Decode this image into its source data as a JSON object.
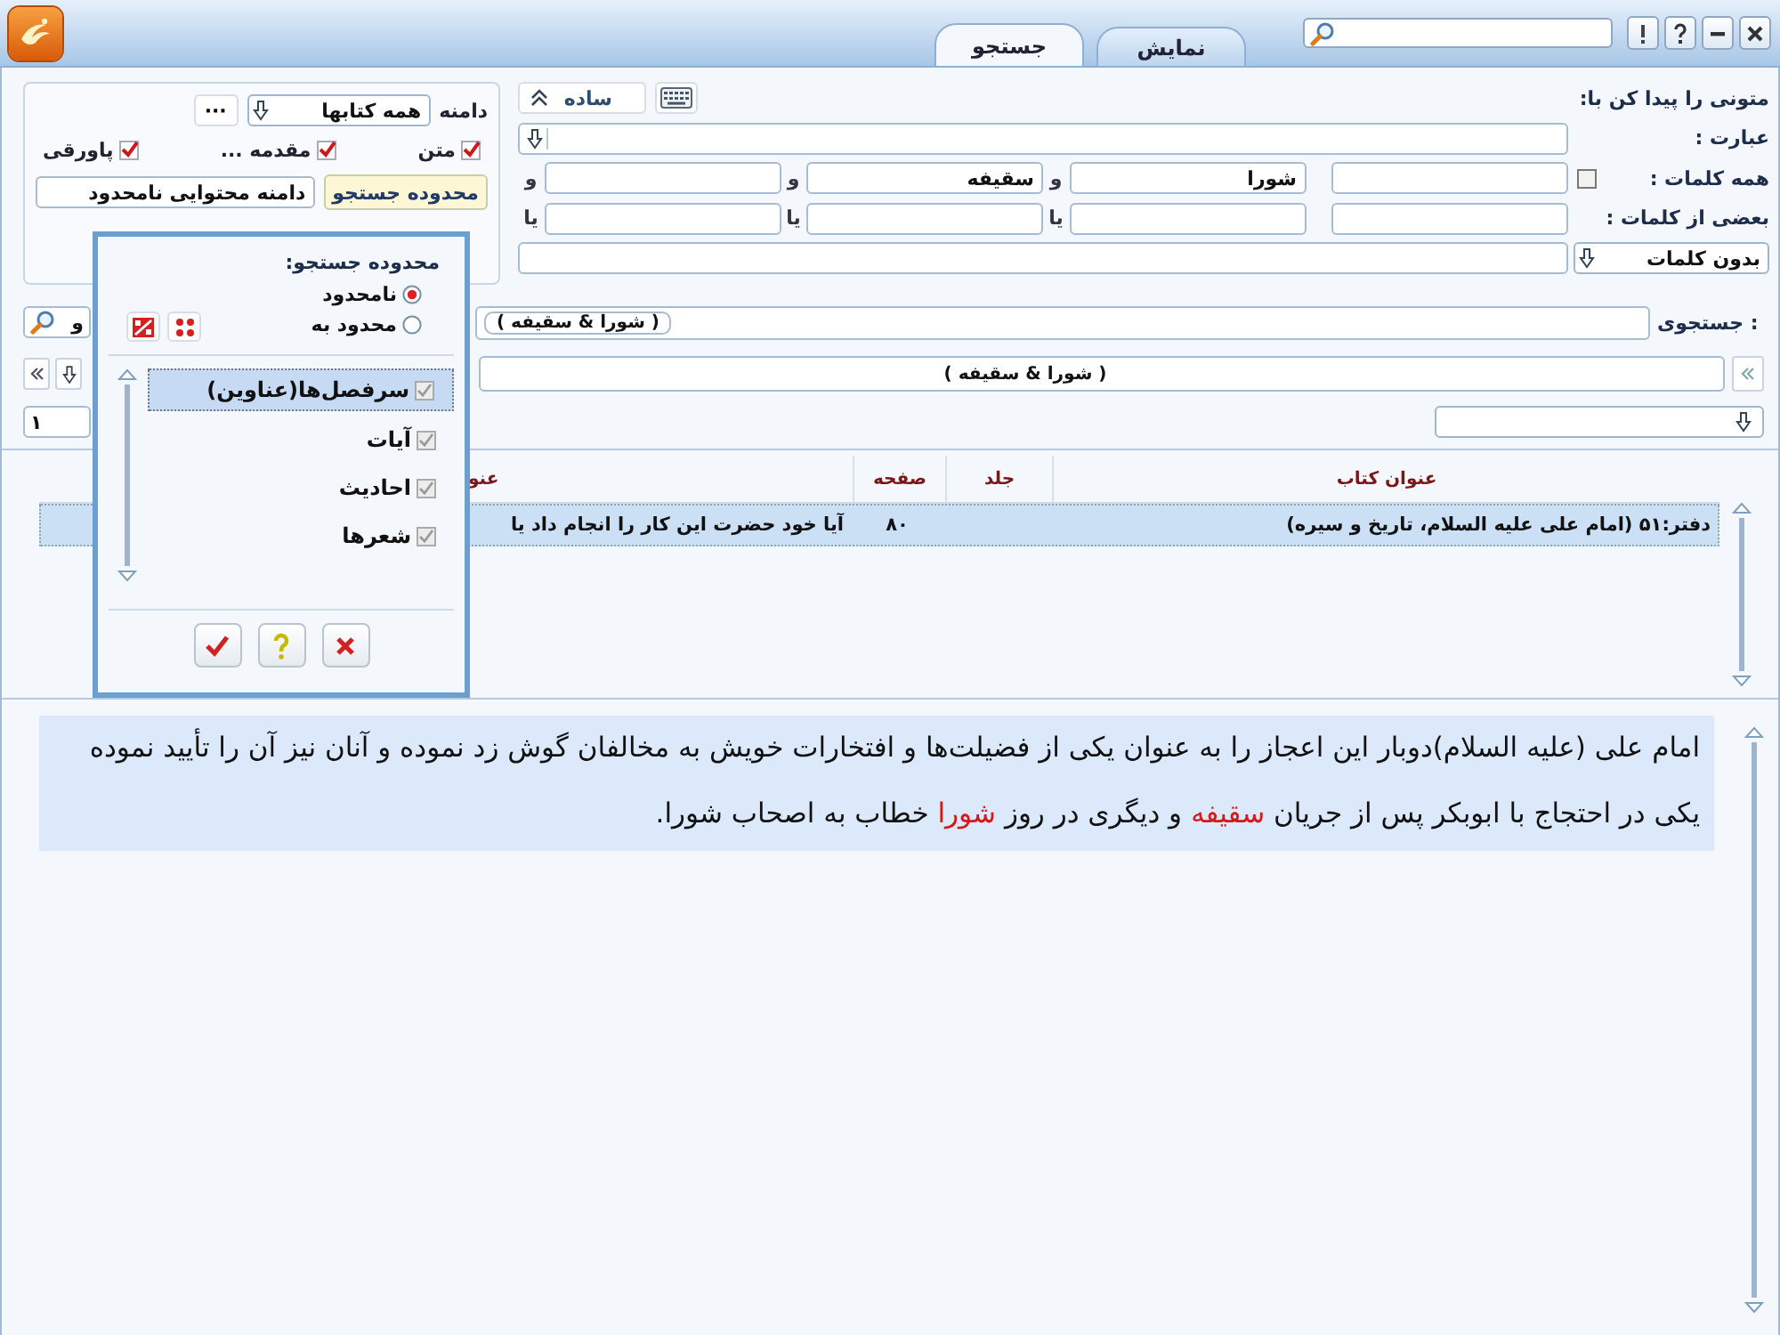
{
  "tabs": [
    {
      "label": "نمایش",
      "selected": false
    },
    {
      "label": "جستجو",
      "selected": true
    }
  ],
  "scope_panel": {
    "domain_label": "دامنه",
    "domain_value": "همه کتابها",
    "more_button": "···",
    "sections": [
      {
        "label": "متن",
        "checked": true
      },
      {
        "label": "مقدمه ...",
        "checked": true
      },
      {
        "label": "پاورقی",
        "checked": true
      }
    ],
    "scope_button": "محدوده جستجو",
    "scope_value": "دامنه محتوایی نامحدود"
  },
  "search_form": {
    "heading": "متونی را پیدا کن با:",
    "mode_button": "ساده",
    "phrase_label": "عبارت :",
    "all_words": {
      "label": "همه کلمات :",
      "checked": false,
      "connectors": [
        "و",
        "و",
        "و"
      ],
      "values": [
        "شورا",
        "سقیفه"
      ]
    },
    "some_words": {
      "label": "بعضی از کلمات :",
      "connectors": [
        "یا",
        "یا",
        "یا"
      ]
    },
    "exclude": {
      "mode": "بدون کلمات"
    }
  },
  "query": {
    "label": "جستجوی :",
    "value": "( شورا & سقیفه )",
    "side_value": "و"
  },
  "expression": {
    "value": "( شورا & سقیفه )"
  },
  "page_field": {
    "value": "۱"
  },
  "results": {
    "columns": [
      "عنوان کتاب",
      "جلد",
      "صفحه",
      "عنو"
    ],
    "rows": [
      {
        "book": "دفتر:۵۱ (امام علی علیه السلام، تاریخ و سیره)",
        "page": "۸۰",
        "title": "آیا خود حضرت این کار را انجام داد یا",
        "selected": true
      }
    ]
  },
  "excerpt": {
    "segments": [
      {
        "text": "امام علی (علیه السلام)دوبار این اعجاز را به عنوان یکی از فضیلت‌ها و افتخارات خویش به مخالفان گوش زد نموده و آنان نیز آن را تأیید نموده یکی در احتجاج با ابوبکر پس از جریان ",
        "highlight": false
      },
      {
        "text": "سقیفه",
        "highlight": true
      },
      {
        "text": " و دیگری در روز ",
        "highlight": false
      },
      {
        "text": "شورا",
        "highlight": true
      },
      {
        "text": " خطاب به اصحاب شورا.",
        "highlight": false
      }
    ]
  },
  "scope_popup": {
    "title": "محدوده جستجو:",
    "options": [
      {
        "label": "نامحدود",
        "selected": true
      },
      {
        "label": "محدود به",
        "selected": false
      }
    ],
    "items_disabled": true,
    "items": [
      {
        "label": "سرفصل‌ها(عناوین)",
        "checked": true,
        "selected": true
      },
      {
        "label": "آیات",
        "checked": true,
        "selected": false
      },
      {
        "label": "احادیث",
        "checked": true,
        "selected": false
      },
      {
        "label": "شعرها",
        "checked": true,
        "selected": false
      }
    ]
  }
}
